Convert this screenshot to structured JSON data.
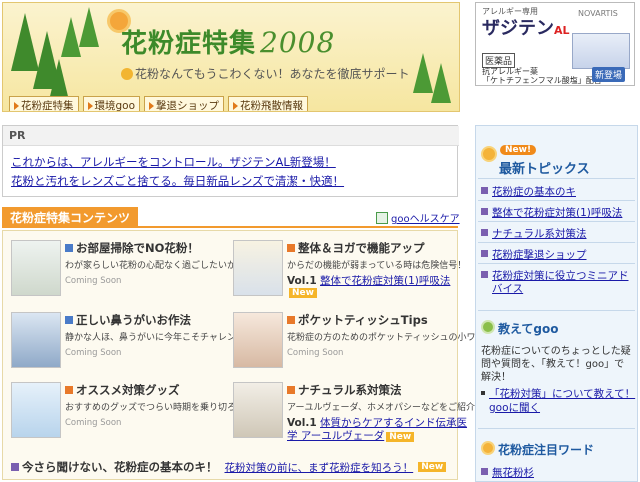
{
  "banner": {
    "title": "花粉症特集",
    "year": "2008",
    "subtitle": "花粉なんてもうこわくない！あなたを徹底サポート",
    "nav": [
      "花粉症特集",
      "環境goo",
      "撃退ショップ",
      "花粉飛散情報"
    ]
  },
  "ad": {
    "top": "アレルギー専用",
    "name": "ザジテン",
    "name_suffix": "AL",
    "logo": "NOVARTIS",
    "tag": "医薬品",
    "line1": "抗アレルギー薬",
    "line2": "「ケトチフェンフマル酸塩」配合",
    "button": "新登場"
  },
  "pr": {
    "header": "PR",
    "links": [
      "これからは、アレルギーをコントロール。ザジテンAL新登場！",
      "花粉と汚れをレンズごと捨てる。毎日新品レンズで清潔・快適！"
    ]
  },
  "contents": {
    "tab": "花粉症特集コンテンツ",
    "goo_link": "gooヘルスケア",
    "items": [
      {
        "title": "お部屋掃除でNO花粉！",
        "desc": "わが家らしい花粉の心配なく過ごしたいから。",
        "status": "Coming Soon"
      },
      {
        "title": "整体＆ヨガで機能アップ",
        "desc": "からだの機能が弱まっている時は危険信号！",
        "vol": "Vol.1",
        "link": "整体で花粉症対策(1)呼吸法",
        "new": "New"
      },
      {
        "title": "正しい鼻うがいお作法",
        "desc": "静かな人ほ、鼻うがいに今年こそチャレンジ。",
        "status": "Coming Soon"
      },
      {
        "title": "ポケットティッシュTips",
        "desc": "花粉症の方のためのポケットティッシュの小ワザ集。",
        "status": "Coming Soon"
      },
      {
        "title": "オススメ対策グッズ",
        "desc": "おすすめのグッズでつらい時期を乗り切ろう！",
        "status": "Coming Soon"
      },
      {
        "title": "ナチュラル系対策法",
        "desc": "アーユルヴェーダ、ホメオパシーなどをご紹介。",
        "vol": "Vol.1",
        "link": "体質からケアするインド伝承医",
        "link2": "学 アーユルヴェーダ",
        "new": "New"
      }
    ],
    "bottom_title": "今さら聞けない、花粉症の基本のキ！",
    "bottom_link": "花粉対策の前に、まず花粉症を知ろう！",
    "bottom_new": "New"
  },
  "right": {
    "new_badge": "New!",
    "topics_title": "最新トピックス",
    "topics": [
      "花粉症の基本のキ",
      "整体で花粉症対策(1)呼吸法",
      "ナチュラル系対策法",
      "花粉症撃退ショップ",
      "花粉症対策に役立つミニアド",
      "バイス"
    ],
    "oshie_title": "教えてgoo",
    "oshie_text": "花粉症についてのちょっとした疑問や質問を、「教えて！goo」で解決！",
    "oshie_link1": "「花粉対策」について教えて！",
    "oshie_link2": "gooに聞く",
    "kw_title": "花粉症注目ワード",
    "kw_first": "無花粉杉"
  }
}
